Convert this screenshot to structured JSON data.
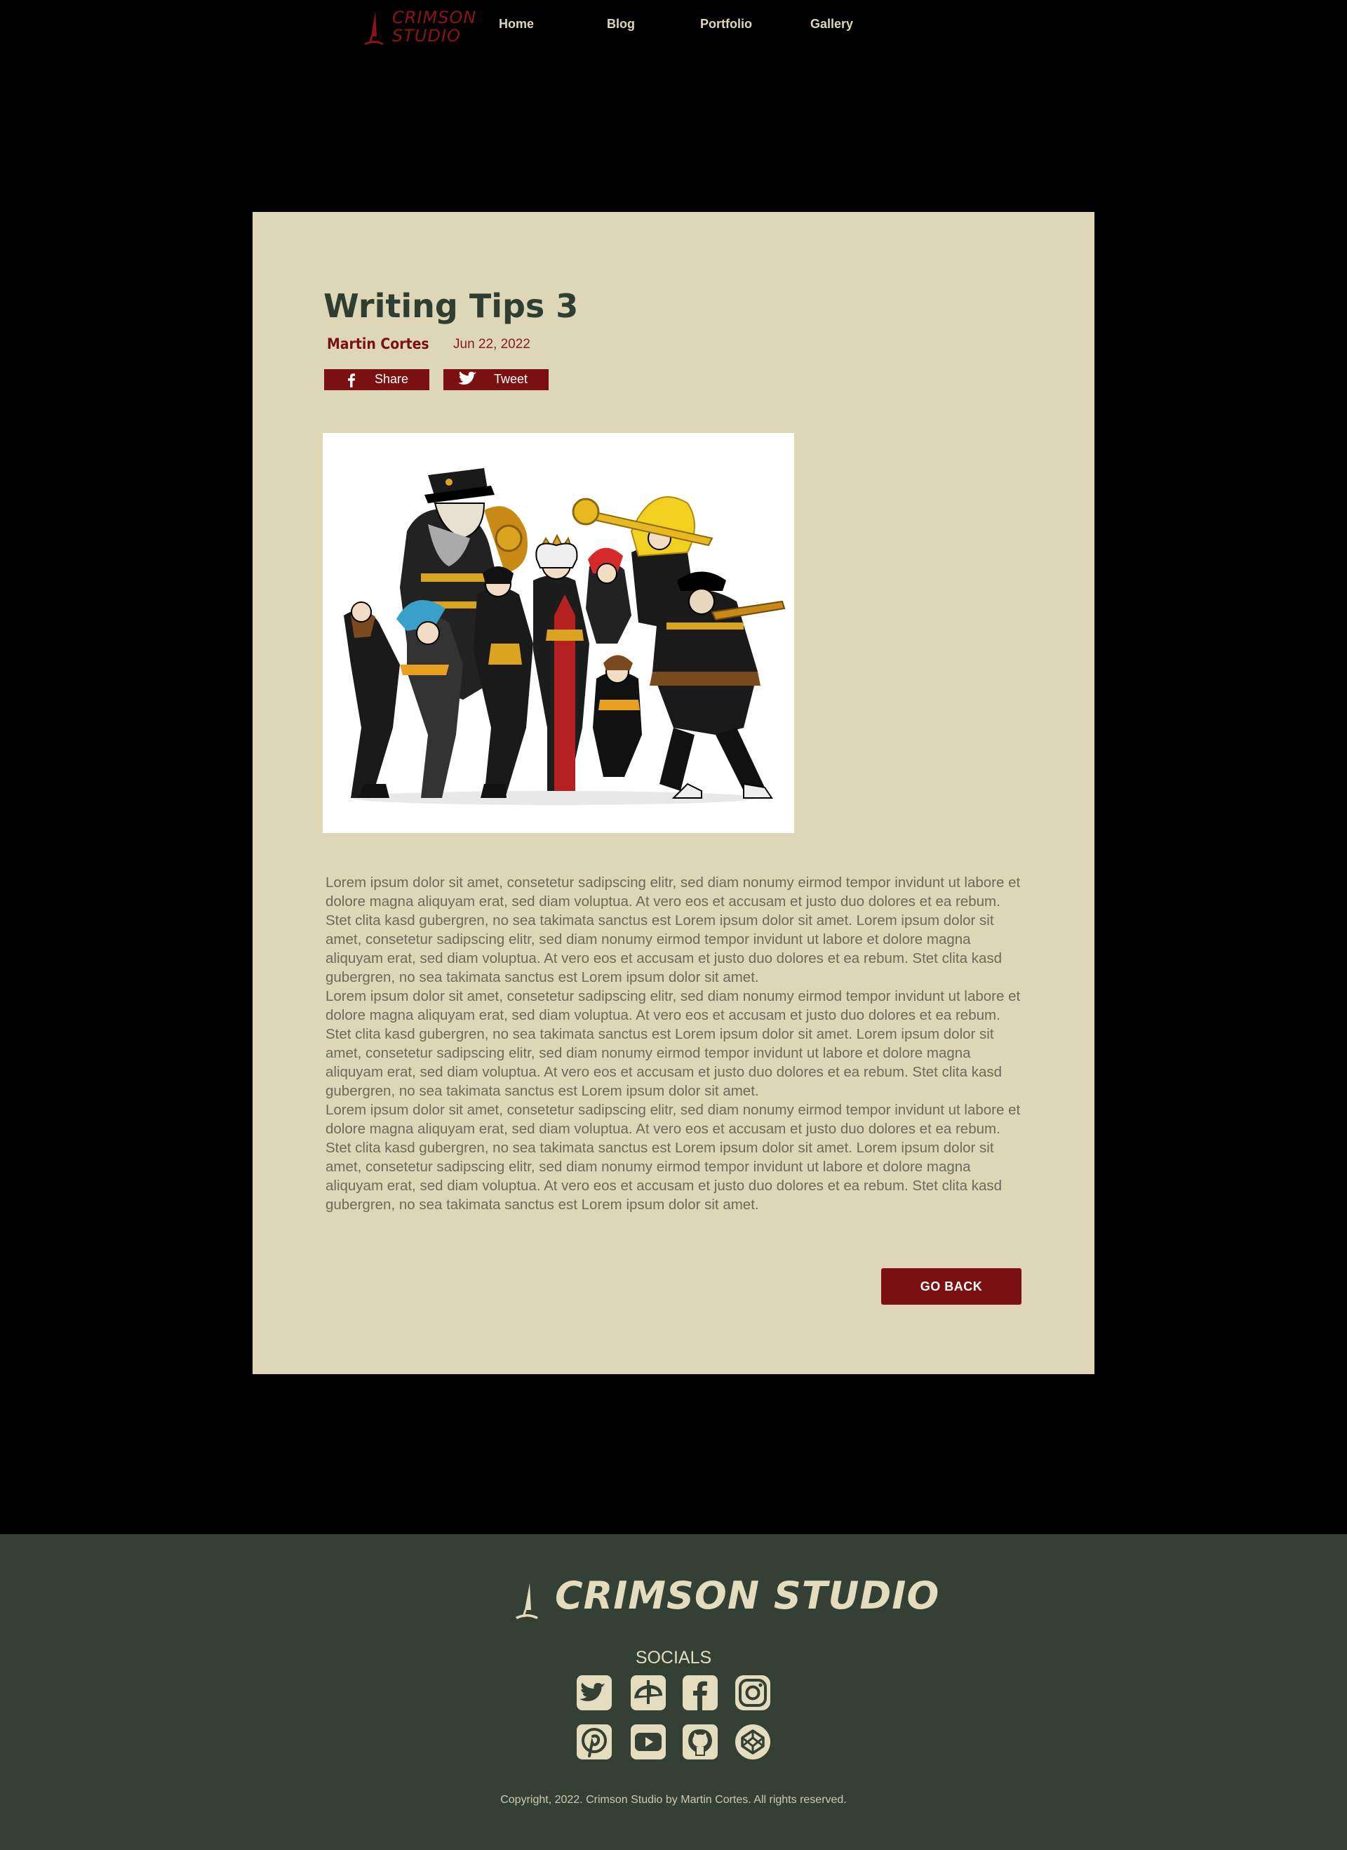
{
  "brand": {
    "logo_line1": "CRIMSON",
    "logo_line2": "STUDIO",
    "footer_name": "CRIMSON STUDIO",
    "logo_color": "#8b1414"
  },
  "nav": [
    {
      "label": "Home"
    },
    {
      "label": "Blog"
    },
    {
      "label": "Portfolio"
    },
    {
      "label": "Gallery"
    }
  ],
  "post": {
    "title": "Writing Tips 3",
    "author": "Martin Cortes",
    "date": "Jun 22, 2022",
    "share_label": "Share",
    "tweet_label": "Tweet",
    "share_icon": "facebook-icon",
    "tweet_icon": "twitter-icon",
    "image_icon": "illustration-steampunk-crew",
    "paragraphs": [
      "Lorem ipsum dolor sit amet, consetetur sadipscing elitr, sed diam nonumy eirmod tempor invidunt ut labore et dolore magna aliquyam erat, sed diam voluptua. At vero eos et accusam et justo duo dolores et ea rebum. Stet clita kasd gubergren, no sea takimata sanctus est Lorem ipsum dolor sit amet. Lorem ipsum dolor sit amet, consetetur sadipscing elitr, sed diam nonumy eirmod tempor invidunt ut labore et dolore magna aliquyam erat, sed diam voluptua. At vero eos et accusam et justo duo dolores et ea rebum. Stet clita kasd gubergren, no sea takimata sanctus est Lorem ipsum dolor sit amet.",
      "Lorem ipsum dolor sit amet, consetetur sadipscing elitr, sed diam nonumy eirmod tempor invidunt ut labore et dolore magna aliquyam erat, sed diam voluptua. At vero eos et accusam et justo duo dolores et ea rebum. Stet clita kasd gubergren, no sea takimata sanctus est Lorem ipsum dolor sit amet. Lorem ipsum dolor sit amet, consetetur sadipscing elitr, sed diam nonumy eirmod tempor invidunt ut labore et dolore magna aliquyam erat, sed diam voluptua. At vero eos et accusam et justo duo dolores et ea rebum. Stet clita kasd gubergren, no sea takimata sanctus est Lorem ipsum dolor sit amet.",
      "Lorem ipsum dolor sit amet, consetetur sadipscing elitr, sed diam nonumy eirmod tempor invidunt ut labore et dolore magna aliquyam erat, sed diam voluptua. At vero eos et accusam et justo duo dolores et ea rebum. Stet clita kasd gubergren, no sea takimata sanctus est Lorem ipsum dolor sit amet. Lorem ipsum dolor sit amet, consetetur sadipscing elitr, sed diam nonumy eirmod tempor invidunt ut labore et dolore magna aliquyam erat, sed diam voluptua. At vero eos et accusam et justo duo dolores et ea rebum. Stet clita kasd gubergren, no sea takimata sanctus est Lorem ipsum dolor sit amet."
    ],
    "go_back_label": "GO BACK"
  },
  "footer": {
    "socials_label": "SOCIALS",
    "social_icons": [
      "twitter-icon",
      "deviantart-icon",
      "facebook-icon",
      "instagram-icon",
      "pinterest-icon",
      "youtube-icon",
      "github-icon",
      "codepen-icon"
    ],
    "copyright": "Copyright, 2022. Crimson Studio by Martin Cortes. All rights reserved."
  },
  "colors": {
    "page_bg": "#000000",
    "card_bg": "#ddd7b8",
    "accent": "#7a1010",
    "title": "#2f3e31",
    "footer_bg": "#334033",
    "footer_fg": "#e3dcbf"
  }
}
